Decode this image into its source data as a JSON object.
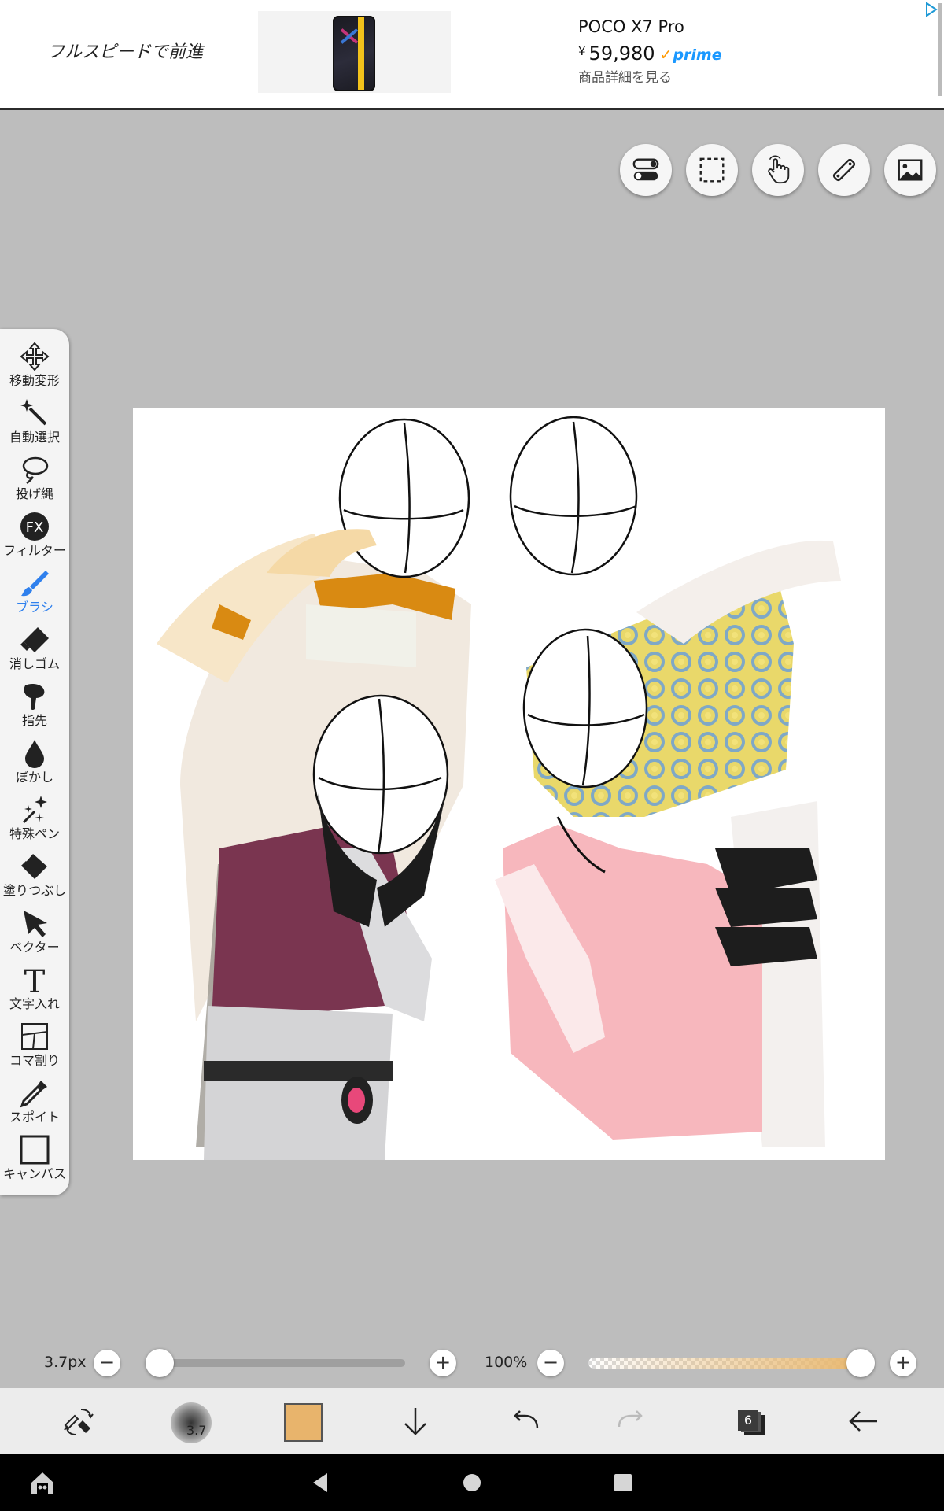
{
  "ad": {
    "slogan": "フルスピードで前進",
    "product_title": "POCO X7 Pro",
    "currency": "¥",
    "price": "59,980",
    "prime": "prime",
    "detail_link": "商品詳細を見る"
  },
  "top_tools": [
    {
      "icon": "toggle-settings-icon"
    },
    {
      "icon": "selection-icon"
    },
    {
      "icon": "hand-touch-icon"
    },
    {
      "icon": "ruler-icon"
    },
    {
      "icon": "image-icon"
    }
  ],
  "toolbar": {
    "items": [
      {
        "label": "移動変形",
        "icon": "move-transform-icon"
      },
      {
        "label": "自動選択",
        "icon": "magic-wand-icon"
      },
      {
        "label": "投げ縄",
        "icon": "lasso-icon"
      },
      {
        "label": "フィルター",
        "icon": "fx-filter-icon"
      },
      {
        "label": "ブラシ",
        "icon": "brush-icon",
        "active": true
      },
      {
        "label": "消しゴム",
        "icon": "eraser-icon"
      },
      {
        "label": "指先",
        "icon": "finger-smudge-icon"
      },
      {
        "label": "ぼかし",
        "icon": "blur-drop-icon"
      },
      {
        "label": "特殊ペン",
        "icon": "special-pen-icon"
      },
      {
        "label": "塗りつぶし",
        "icon": "fill-bucket-icon"
      },
      {
        "label": "ベクター",
        "icon": "vector-arrow-icon"
      },
      {
        "label": "文字入れ",
        "icon": "text-icon"
      },
      {
        "label": "コマ割り",
        "icon": "panel-frame-icon"
      },
      {
        "label": "スポイト",
        "icon": "eyedropper-icon"
      },
      {
        "label": "キャンバス",
        "icon": "canvas-icon"
      }
    ],
    "active_color": "#2f80ed"
  },
  "sliders": {
    "brush_size_label": "3.7px",
    "brush_size_fraction": 0.0,
    "opacity_label": "100%",
    "opacity_fraction": 1.0,
    "minus": "−",
    "plus": "+"
  },
  "bottombar": {
    "brush_preview_size": "3.7",
    "current_color": "#e8b46c",
    "layer_count": "6"
  },
  "fx_label": "FX",
  "text_tool_glyph": "T"
}
